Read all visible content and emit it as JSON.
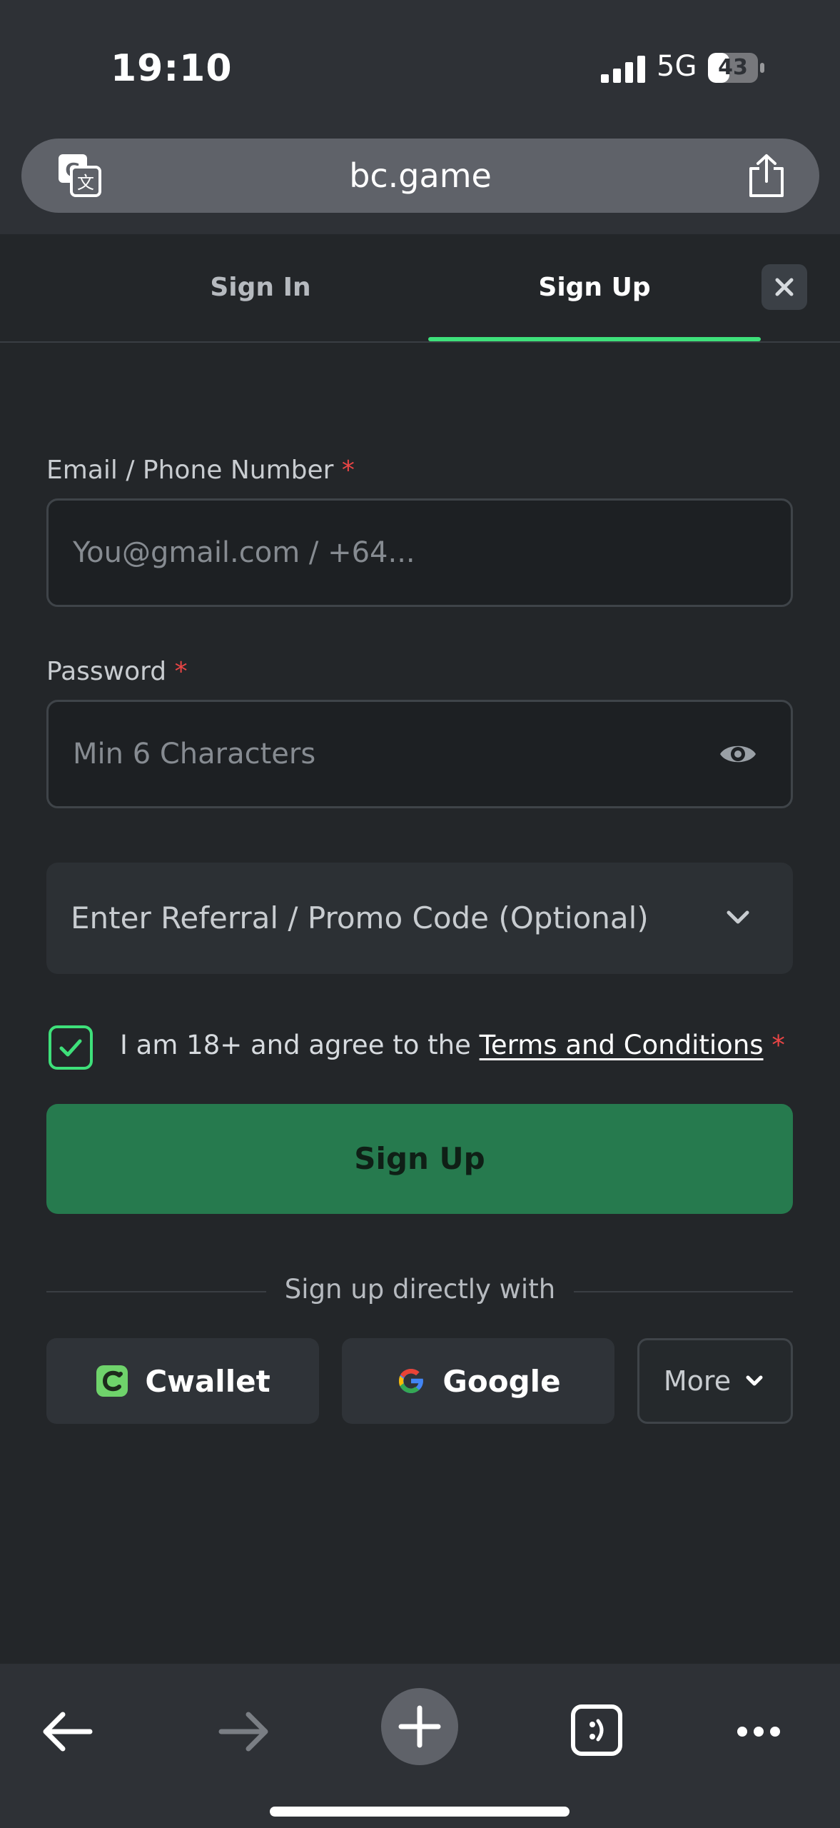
{
  "status_bar": {
    "time": "19:10",
    "network": "5G",
    "battery_text": "43",
    "battery_level": 0.43
  },
  "browser": {
    "url": "bc.game",
    "icons": [
      "translate-icon",
      "share-icon"
    ]
  },
  "tabs": {
    "sign_in": "Sign In",
    "sign_up": "Sign Up",
    "active": "sign_up"
  },
  "form": {
    "email_label": "Email / Phone Number",
    "email_placeholder": "You@gmail.com / +64...",
    "password_label": "Password",
    "password_placeholder": "Min 6 Characters",
    "required_mark": "*",
    "referral_label": "Enter Referral / Promo Code (Optional)",
    "agree_text": "I am 18+ and agree to the ",
    "terms_link": "Terms and Conditions",
    "agree_checked": true,
    "submit_label": "Sign Up"
  },
  "social": {
    "divider_text": "Sign up directly with",
    "cwallet_label": "Cwallet",
    "google_label": "Google",
    "more_label": "More"
  },
  "colors": {
    "accent_green": "#3ee07a",
    "button_green": "#267a4e",
    "required_red": "#e94545"
  }
}
